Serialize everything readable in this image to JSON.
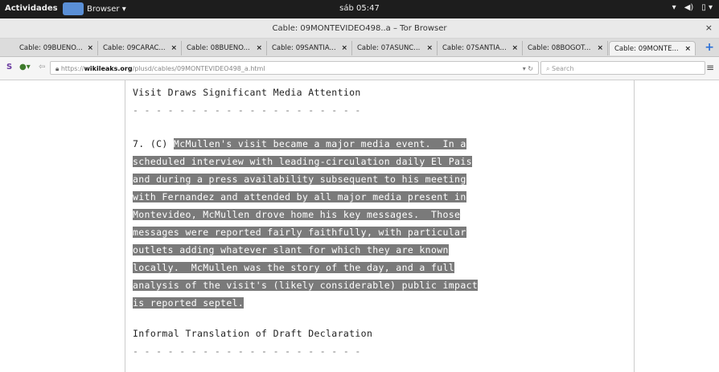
{
  "topbar": {
    "activities": "Actividades",
    "app": "Browser ▾",
    "clock": "sáb 05:47",
    "tray": [
      "▾",
      "◀)",
      "▯ ▾"
    ]
  },
  "window": {
    "title": "Cable: 09MONTEVIDEO498..a – Tor Browser",
    "close": "×"
  },
  "tabs": [
    "Cable: 09BUENO...",
    "Cable: 09CARAC...",
    "Cable: 08BUENO...",
    "Cable: 09SANTIA...",
    "Cable: 07ASUNC...",
    "Cable: 07SANTIA...",
    "Cable: 08BOGOT...",
    "Cable: 09MONTE..."
  ],
  "tab_close": "×",
  "navbar": {
    "url_prefix": "https://",
    "url_domain": "wikileaks.org",
    "url_path": "/plusd/cables/09MONTEVIDEO498_a.html",
    "search_placeholder": "Search"
  },
  "content": {
    "heading1": "Visit Draws Significant Media Attention",
    "dashes": "- - - - - - - - - - - - - - - - - - - -",
    "para_label": "7. (C) ",
    "para_lines": [
      "McMullen's visit became a major media event.  In a",
      "scheduled interview with leading-circulation daily El Pais",
      "and during a press availability subsequent to his meeting",
      "with Fernandez and attended by all major media present in",
      "Montevideo, McMullen drove home his key messages.  Those",
      "messages were reported fairly faithfully, with particular",
      "outlets adding whatever slant for which they are known",
      "locally.  McMullen was the story of the day, and a full",
      "analysis of the visit's (likely considerable) public impact",
      "is reported septel."
    ],
    "heading2": "Informal Translation of Draft Declaration"
  }
}
